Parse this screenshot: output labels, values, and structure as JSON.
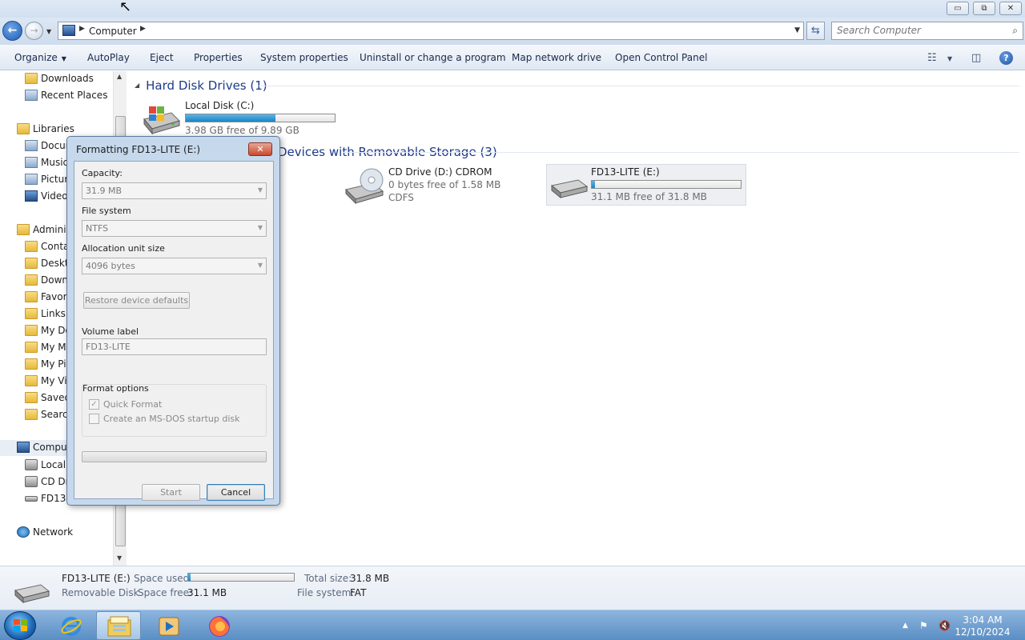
{
  "window": {
    "minimize": "▭",
    "restore": "⧉",
    "close": "✕"
  },
  "address": {
    "crumb": "Computer",
    "search_placeholder": "Search Computer"
  },
  "toolbar": {
    "organize": "Organize",
    "autoplay": "AutoPlay",
    "eject": "Eject",
    "properties": "Properties",
    "system_properties": "System properties",
    "uninstall": "Uninstall or change a program",
    "map_drive": "Map network drive",
    "control_panel": "Open Control Panel"
  },
  "nav": {
    "items": [
      {
        "label": "Downloads",
        "icon": "folder-icon"
      },
      {
        "label": "Recent Places",
        "icon": "recent-places-icon"
      },
      {
        "label": "Libraries",
        "icon": "libraries-icon"
      },
      {
        "label": "Documents",
        "icon": "documents-icon"
      },
      {
        "label": "Music",
        "icon": "music-icon"
      },
      {
        "label": "Pictures",
        "icon": "pictures-icon"
      },
      {
        "label": "Videos",
        "icon": "videos-icon"
      },
      {
        "label": "Administrator",
        "icon": "user-folder-icon"
      },
      {
        "label": "Contacts",
        "icon": "folder-icon"
      },
      {
        "label": "Desktop",
        "icon": "folder-icon"
      },
      {
        "label": "Downloads",
        "icon": "folder-icon"
      },
      {
        "label": "Favorites",
        "icon": "folder-icon"
      },
      {
        "label": "Links",
        "icon": "folder-icon"
      },
      {
        "label": "My Documents",
        "icon": "folder-icon"
      },
      {
        "label": "My Music",
        "icon": "folder-icon"
      },
      {
        "label": "My Pictures",
        "icon": "folder-icon"
      },
      {
        "label": "My Videos",
        "icon": "folder-icon"
      },
      {
        "label": "Saved Games",
        "icon": "folder-icon"
      },
      {
        "label": "Searches",
        "icon": "folder-icon"
      },
      {
        "label": "Computer",
        "icon": "computer-icon"
      },
      {
        "label": "Local Disk (C:)",
        "icon": "disk-icon"
      },
      {
        "label": "CD Drive (D:) CDROM",
        "icon": "cd-icon"
      },
      {
        "label": "FD13-LITE (E:)",
        "icon": "usb-drive-icon"
      },
      {
        "label": "Network",
        "icon": "network-icon"
      }
    ]
  },
  "content": {
    "hdd_group": "Hard Disk Drives (1)",
    "removable_group": "Devices with Removable Storage (3)",
    "local_disk": {
      "name": "Local Disk (C:)",
      "free": "3.98 GB free of 9.89 GB",
      "used_fraction": 0.6
    },
    "cd_drive": {
      "name": "CD Drive (D:) CDROM",
      "free": "0 bytes free of 1.58 MB",
      "fs": "CDFS"
    },
    "usb_drive": {
      "name": "FD13-LITE (E:)",
      "free": "31.1 MB free of 31.8 MB",
      "used_fraction": 0.02
    }
  },
  "details": {
    "name": "FD13-LITE (E:)",
    "type": "Removable Disk",
    "space_used_label": "Space used:",
    "space_free_label": "Space free:",
    "space_free": "31.1 MB",
    "total_size_label": "Total size:",
    "total_size": "31.8 MB",
    "fs_label": "File system:",
    "fs": "FAT",
    "used_fraction": 0.02
  },
  "dialog": {
    "title": "Formatting FD13-LITE (E:)",
    "capacity_label": "Capacity:",
    "capacity": "31.9 MB",
    "fs_label": "File system",
    "fs": "NTFS",
    "alloc_label": "Allocation unit size",
    "alloc": "4096 bytes",
    "restore_btn": "Restore device defaults",
    "volume_label": "Volume label",
    "volume": "FD13-LITE",
    "options_label": "Format options",
    "quick_format": "Quick Format",
    "msdos": "Create an MS-DOS startup disk",
    "start": "Start",
    "cancel": "Cancel",
    "progress": 0
  },
  "taskbar": {
    "time": "3:04 AM",
    "date": "12/10/2024"
  }
}
